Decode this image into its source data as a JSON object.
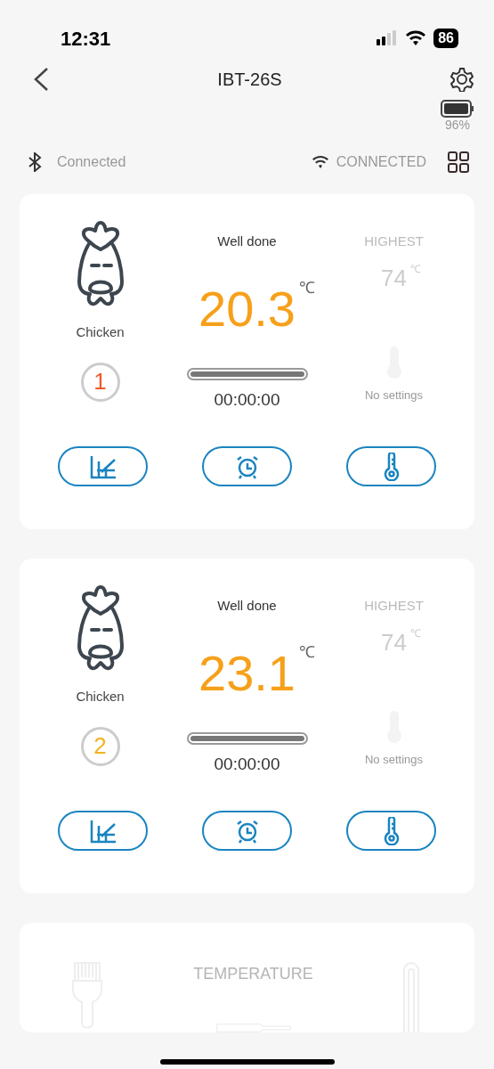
{
  "status_bar": {
    "time": "12:31",
    "battery": "86"
  },
  "header": {
    "title": "IBT-26S",
    "device_battery": "96%"
  },
  "connections": {
    "bluetooth": "Connected",
    "wifi": "CONNECTED"
  },
  "probes": [
    {
      "food": "Chicken",
      "number": "1",
      "color": "#f05a28",
      "doneness": "Well done",
      "temperature": "20.3",
      "unit": "℃",
      "highest_label": "HIGHEST",
      "target": "74",
      "target_unit": "℃",
      "level": 1,
      "timer": "00:00:00",
      "setting": "No settings"
    },
    {
      "food": "Chicken",
      "number": "2",
      "color": "#f2b320",
      "doneness": "Well done",
      "temperature": "23.1",
      "unit": "℃",
      "highest_label": "HIGHEST",
      "target": "74",
      "target_unit": "℃",
      "level": 1,
      "timer": "00:00:00",
      "setting": "No settings"
    }
  ],
  "empty_card": {
    "label": "TEMPERATURE"
  }
}
